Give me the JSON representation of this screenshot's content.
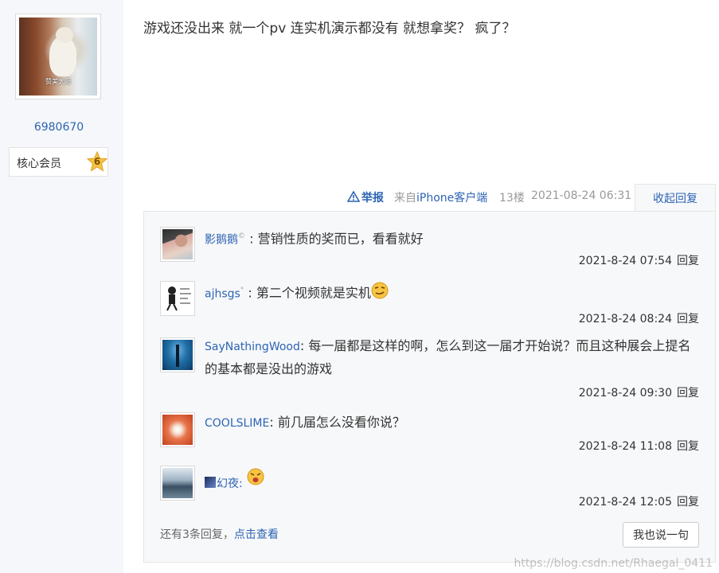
{
  "author": {
    "avatar_caption": "赞美太阳",
    "name": "6980670",
    "member_label": "核心会员",
    "member_level": "6"
  },
  "post": {
    "content": "游戏还没出来 就一个pv 连实机演示都没有 就想拿奖？ 疯了？",
    "report_label": "举报",
    "client_prefix": "来自",
    "client_name": "iPhone客户端",
    "floor": "13楼",
    "time": "2021-08-24 06:31",
    "collapse_label": "收起回复"
  },
  "replies": [
    {
      "user": "影鹅鹅",
      "vip": "©",
      "text": ": 营销性质的奖而已，看看就好",
      "time": "2021-8-24 07:54",
      "reply_label": "回复"
    },
    {
      "user": "ajhsgs",
      "vip": "°",
      "text": ": 第二个视频就是实机",
      "emoji": "smug-face-emoji",
      "time": "2021-8-24 08:24",
      "reply_label": "回复"
    },
    {
      "user": "SayNathingWood",
      "text": ": 每一届都是这样的啊，怎么到这一届才开始说？而且这种展会上提名的基本都是没出的游戏",
      "time": "2021-8-24 09:30",
      "reply_label": "回复"
    },
    {
      "user": "COOLSLIME",
      "text": ": 前几届怎么没看你说？",
      "time": "2021-8-24 11:08",
      "reply_label": "回复"
    },
    {
      "user": "幻夜",
      "text": ":",
      "emoji": "shocked-face-emoji",
      "time": "2021-8-24 12:05",
      "reply_label": "回复"
    }
  ],
  "footer": {
    "more_prefix": "还有3条回复，",
    "more_link": "点击查看",
    "say_button": "我也说一句"
  },
  "watermark": "https://blog.csdn.net/Rhaegal_0411",
  "colors": {
    "link": "#2d64b3",
    "left_panel": "#f5f7fa",
    "reply_box": "#f7f8fa"
  }
}
